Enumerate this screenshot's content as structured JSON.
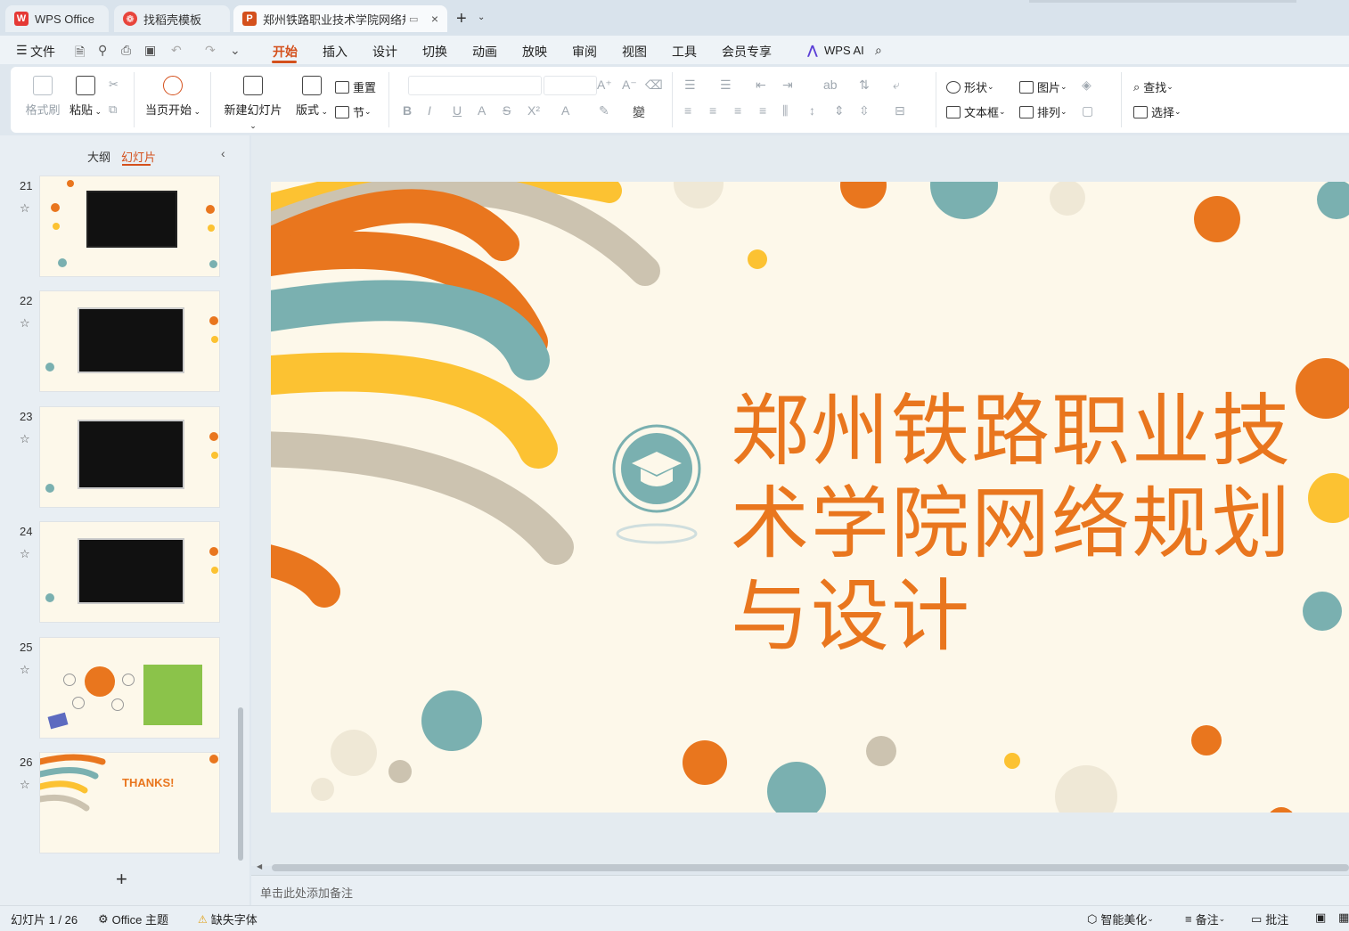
{
  "titlebar": {
    "tabs": [
      {
        "label": "WPS Office"
      },
      {
        "label": "找稻壳模板"
      },
      {
        "label": "郑州铁路职业技术学院网络规划"
      }
    ],
    "new_tab": "+",
    "new_tab_dropdown": "⌄",
    "close": "×"
  },
  "menubar": {
    "file": "文件",
    "items": [
      "开始",
      "插入",
      "设计",
      "切换",
      "动画",
      "放映",
      "审阅",
      "视图",
      "工具",
      "会员专享"
    ],
    "active": "开始",
    "wps_ai": "WPS AI"
  },
  "ribbon": {
    "format_painter": "格式刷",
    "paste": "粘贴",
    "from_current": "当页开始",
    "new_slide": "新建幻灯片",
    "layout": "版式",
    "section": "节",
    "reset": "重置",
    "shape": "形状",
    "picture": "图片",
    "textbox": "文本框",
    "arrange": "排列",
    "find": "查找",
    "select": "选择"
  },
  "left_panel": {
    "tab_outline": "大纲",
    "tab_slides": "幻灯片",
    "slides": [
      {
        "number": "21"
      },
      {
        "number": "22"
      },
      {
        "number": "23"
      },
      {
        "number": "24"
      },
      {
        "number": "25"
      },
      {
        "number": "26",
        "text": "THANKS!"
      }
    ]
  },
  "slide": {
    "title": "郑州铁路职业技术学院网络规划与设计"
  },
  "notes": {
    "placeholder": "单击此处添加备注"
  },
  "statusbar": {
    "slide_info": "幻灯片 1 / 26",
    "theme": "Office 主题",
    "missing_font": "缺失字体",
    "smart_beautify": "智能美化",
    "notes": "备注",
    "comments": "批注"
  },
  "colors": {
    "accent": "#d4501c",
    "orange": "#e9761e",
    "teal": "#7ab0b0",
    "yellow": "#fcc232",
    "beige": "#ccc3b0"
  }
}
